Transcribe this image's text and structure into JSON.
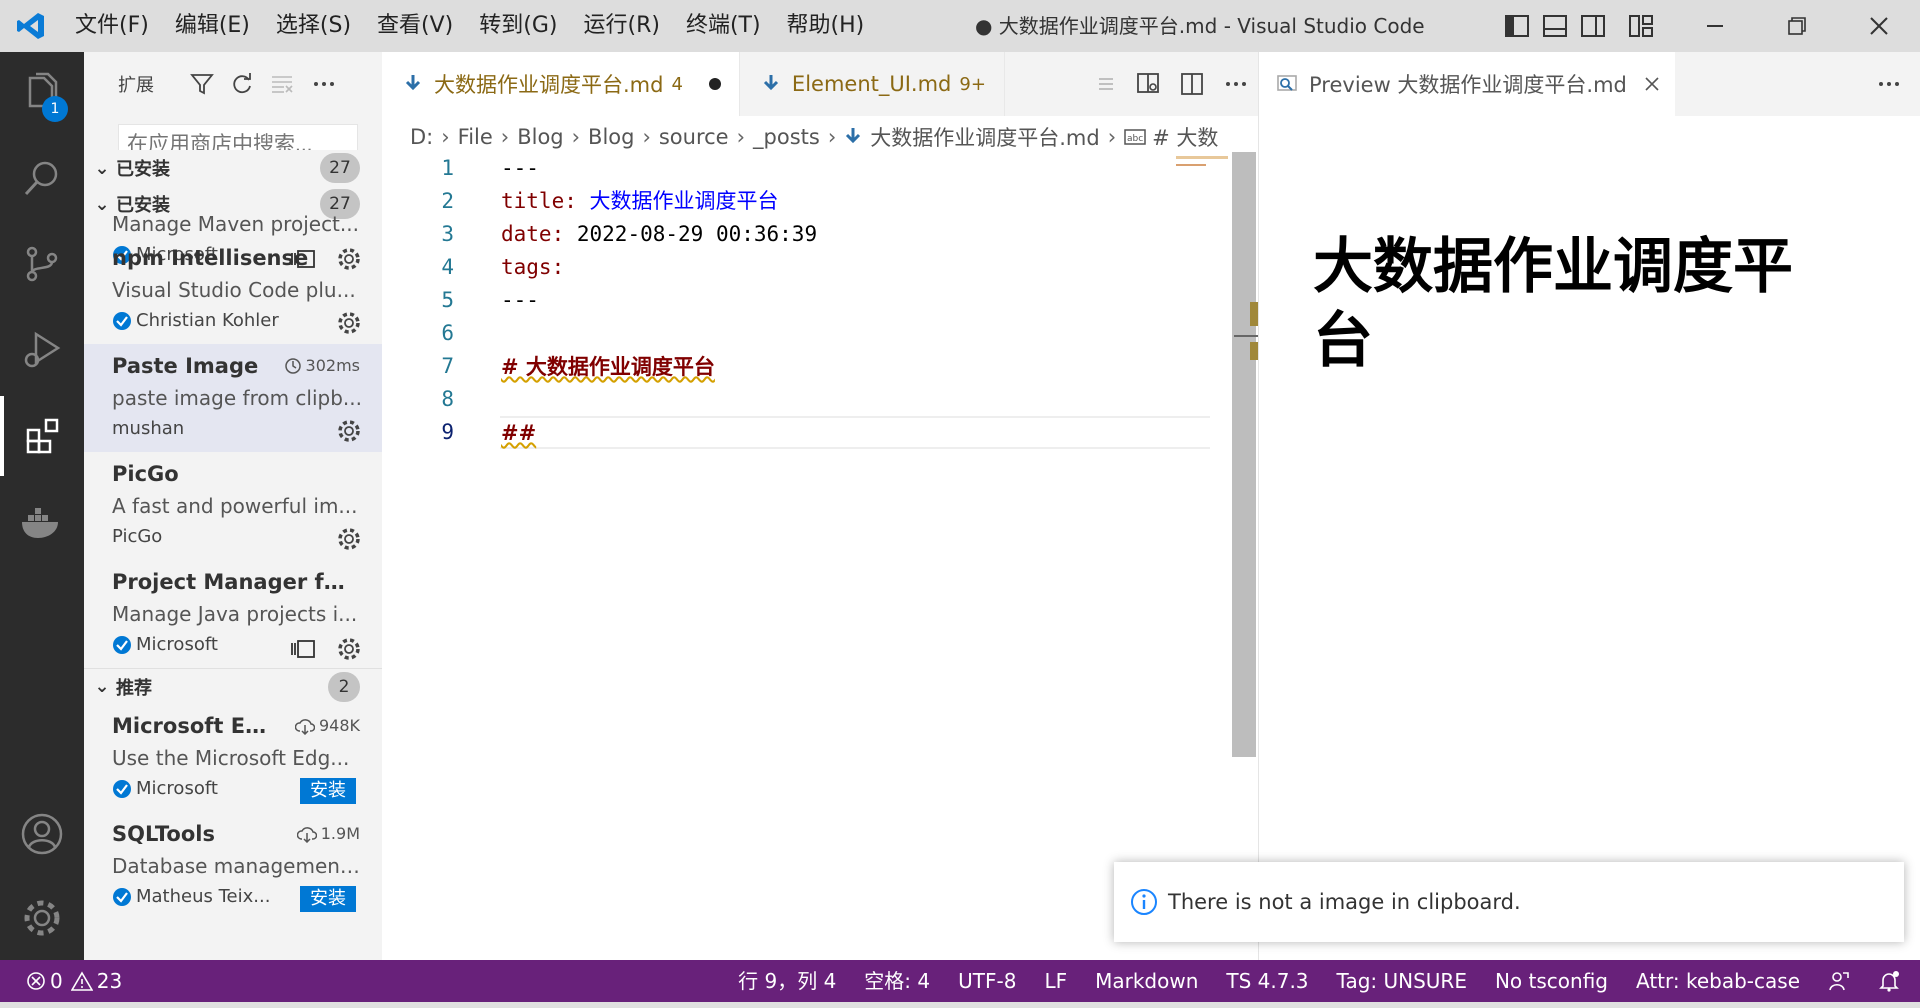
{
  "window": {
    "title": "● 大数据作业调度平台.md - Visual Studio Code"
  },
  "menu": [
    {
      "label": "文件(F)"
    },
    {
      "label": "编辑(E)"
    },
    {
      "label": "选择(S)"
    },
    {
      "label": "查看(V)"
    },
    {
      "label": "转到(G)"
    },
    {
      "label": "运行(R)"
    },
    {
      "label": "终端(T)"
    },
    {
      "label": "帮助(H)"
    }
  ],
  "activity": {
    "explorer_badge": "1"
  },
  "sidebar": {
    "title": "扩展",
    "search_placeholder": "在应用商店中搜索...",
    "installed": {
      "label": "已安装",
      "count": "27",
      "items": [
        {
          "name": "",
          "desc": "Manage Maven project...",
          "publisher": "Microsoft",
          "verified": true
        },
        {
          "name": "npm Intellisense",
          "desc": "Visual Studio Code plu...",
          "publisher": "Christian Kohler",
          "verified": true
        },
        {
          "name": "Paste Image",
          "desc": "paste image from clipb...",
          "publisher": "mushan",
          "verified": false,
          "time": "302ms"
        },
        {
          "name": "PicGo",
          "desc": "A fast and powerful im...",
          "publisher": "PicGo",
          "verified": false
        },
        {
          "name": "Project Manager for ...",
          "desc": "Manage Java projects i...",
          "publisher": "Microsoft",
          "verified": true
        }
      ]
    },
    "recommended": {
      "label": "推荐",
      "count": "2",
      "items": [
        {
          "name": "Microsoft Ed...",
          "desc": "Use the Microsoft Edg...",
          "publisher": "Microsoft",
          "downloads": "948K",
          "install": "安装"
        },
        {
          "name": "SQLTools",
          "desc": "Database management...",
          "publisher": "Matheus Teix...",
          "downloads": "1.9M",
          "install": "安装"
        }
      ]
    }
  },
  "tabs": [
    {
      "label": "大数据作业调度平台.md",
      "problems": "4"
    },
    {
      "label": "Element_UI.md",
      "problems": "9+"
    }
  ],
  "breadcrumb": [
    "D:",
    "File",
    "Blog",
    "Blog",
    "source",
    "_posts",
    "大数据作业调度平台.md",
    "# 大数"
  ],
  "code": {
    "lines": [
      "1",
      "2",
      "3",
      "4",
      "5",
      "6",
      "7",
      "8",
      "9"
    ],
    "l1": "---",
    "l2_key": "title:",
    "l2_val": "大数据作业调度平台",
    "l3_key": "date:",
    "l3_val": "2022-08-29 00:36:39",
    "l4_key": "tags:",
    "l5": "---",
    "l7": "# 大数据作业调度平台",
    "l9": "##"
  },
  "preview": {
    "tab": "Preview 大数据作业调度平台.md",
    "heading": "大数据作业调度平台"
  },
  "notification": {
    "text": "There is not a image in clipboard."
  },
  "statusbar": {
    "errors": "0",
    "warnings": "23",
    "position": "行 9，列 4",
    "spaces": "空格: 4",
    "encoding": "UTF-8",
    "eol": "LF",
    "language": "Markdown",
    "ts": "TS 4.7.3",
    "tag": "Tag: UNSURE",
    "tsconfig": "No tsconfig",
    "attr": "Attr: kebab-case"
  },
  "colors": {
    "statusbar": "#68217a",
    "accent": "#0078d4",
    "activitybar": "#2c2c2c"
  }
}
